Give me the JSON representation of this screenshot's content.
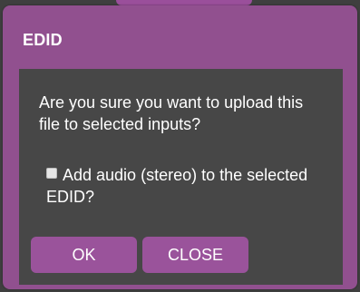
{
  "dialog": {
    "title": "EDID",
    "message": "Are you sure you want to upload this file to selected inputs?",
    "checkbox_label": "Add audio (stereo) to the selected EDID?",
    "checkbox_checked": false,
    "ok_label": "OK",
    "close_label": "CLOSE"
  },
  "colors": {
    "dialog_header": "#91508f",
    "dialog_body": "#474747",
    "button": "#9a539b",
    "text": "#ffffff"
  }
}
